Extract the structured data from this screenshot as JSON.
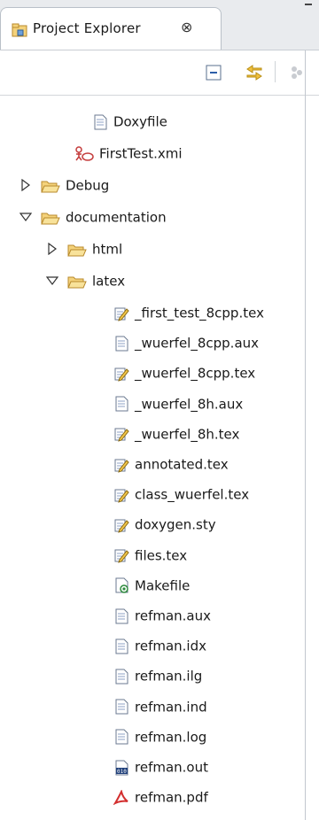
{
  "tab": {
    "label": "Project Explorer",
    "close_glyph": "⊗"
  },
  "toolbar": {
    "collapse_all": "collapse-all-icon",
    "link_editor": "link-with-editor-icon",
    "view_menu": "view-menu-icon"
  },
  "tree": {
    "doxyfile": "Doxyfile",
    "firsttest": "FirstTest.xmi",
    "debug": "Debug",
    "documentation": "documentation",
    "html": "html",
    "latex": "latex",
    "files": [
      {
        "name": "_first_test_8cpp.tex",
        "icon": "tex-edit-icon"
      },
      {
        "name": "_wuerfel_8cpp.aux",
        "icon": "text-file-icon"
      },
      {
        "name": "_wuerfel_8cpp.tex",
        "icon": "tex-edit-icon"
      },
      {
        "name": "_wuerfel_8h.aux",
        "icon": "text-file-icon"
      },
      {
        "name": "_wuerfel_8h.tex",
        "icon": "tex-edit-icon"
      },
      {
        "name": "annotated.tex",
        "icon": "tex-edit-icon"
      },
      {
        "name": "class_wuerfel.tex",
        "icon": "tex-edit-icon"
      },
      {
        "name": "doxygen.sty",
        "icon": "tex-edit-icon"
      },
      {
        "name": "files.tex",
        "icon": "tex-edit-icon"
      },
      {
        "name": "Makefile",
        "icon": "makefile-icon"
      },
      {
        "name": "refman.aux",
        "icon": "text-file-icon"
      },
      {
        "name": "refman.idx",
        "icon": "text-file-icon"
      },
      {
        "name": "refman.ilg",
        "icon": "text-file-icon"
      },
      {
        "name": "refman.ind",
        "icon": "text-file-icon"
      },
      {
        "name": "refman.log",
        "icon": "text-file-icon"
      },
      {
        "name": "refman.out",
        "icon": "binary-file-icon"
      },
      {
        "name": "refman.pdf",
        "icon": "pdf-file-icon"
      }
    ]
  },
  "colors": {
    "folder": "#e8b64a",
    "selection": "#ffffff",
    "pdf": "#d32f2f"
  }
}
